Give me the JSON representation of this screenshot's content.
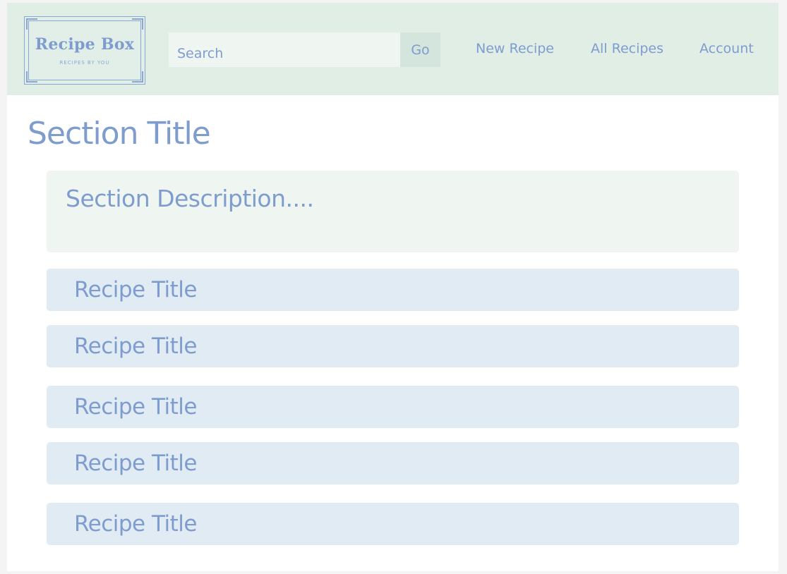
{
  "header": {
    "logo": {
      "title": "Recipe Box",
      "subtitle": "RECIPES BY YOU"
    },
    "search": {
      "placeholder": "Search",
      "button_label": "Go"
    },
    "nav": {
      "new_recipe": "New Recipe",
      "all_recipes": "All Recipes",
      "account": "Account"
    }
  },
  "main": {
    "section_title": "Section Title",
    "section_description": "Section Description....",
    "recipes": [
      {
        "title": "Recipe Title"
      },
      {
        "title": "Recipe Title"
      },
      {
        "title": "Recipe Title"
      },
      {
        "title": "Recipe Title"
      },
      {
        "title": "Recipe Title"
      }
    ]
  },
  "colors": {
    "accent_text": "#7f9ccf",
    "header_background": "#e0eee6",
    "input_background": "#eff6f1",
    "button_background": "#d3e5dc",
    "recipe_row_background": "#e1ebf4"
  }
}
